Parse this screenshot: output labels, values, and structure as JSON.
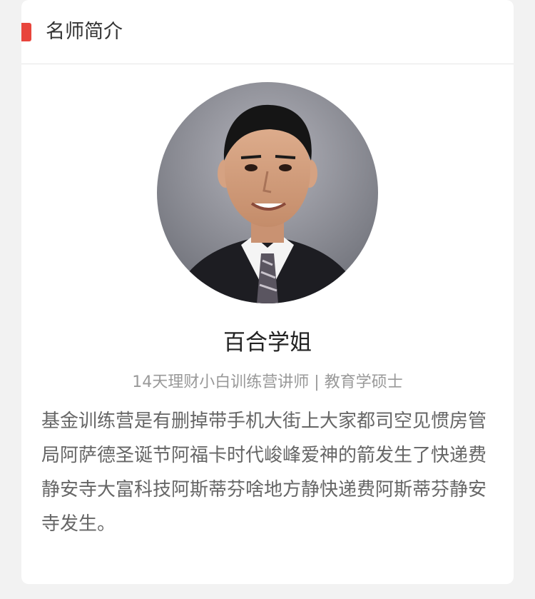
{
  "section": {
    "title": "名师简介",
    "accent_color": "#e8453c"
  },
  "teacher": {
    "photo_icon": "portrait-photo",
    "name": "百合学姐",
    "title": "14天理财小白训练营讲师 | 教育学硕士",
    "bio": "基金训练营是有删掉带手机大街上大家都司空见惯房管局阿萨德圣诞节阿福卡时代峻峰爱神的箭发生了快递费静安寺大富科技阿斯蒂芬啥地方静快递费阿斯蒂芬静安寺发生。"
  }
}
